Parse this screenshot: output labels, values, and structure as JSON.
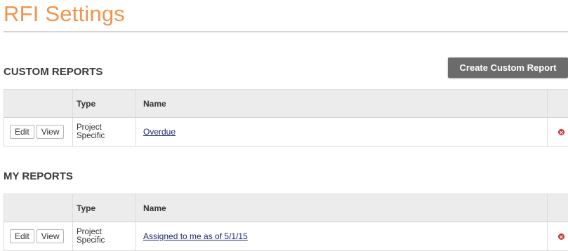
{
  "page": {
    "title": "RFI Settings"
  },
  "custom_reports": {
    "heading": "CUSTOM REPORTS",
    "create_button_label": "Create Custom Report",
    "columns": [
      "",
      "Type",
      "Name",
      ""
    ],
    "rows": [
      {
        "edit_label": "Edit",
        "view_label": "View",
        "type_line1": "Project",
        "type_line2": "Specific",
        "name": "Overdue"
      }
    ]
  },
  "my_reports": {
    "heading": "MY REPORTS",
    "columns": [
      "",
      "Type",
      "Name",
      ""
    ],
    "rows": [
      {
        "edit_label": "Edit",
        "view_label": "View",
        "type_line1": "Project",
        "type_line2": "Specific",
        "name": "Assigned to me as of 5/1/15"
      }
    ]
  },
  "colors": {
    "title": "#f0944d",
    "create_button_bg": "#6b6b6b",
    "header_row_bg": "#ececec",
    "link": "#1d2a6e",
    "delete_icon": "#c9352f"
  },
  "icons": {
    "delete": "circle-x-icon"
  }
}
